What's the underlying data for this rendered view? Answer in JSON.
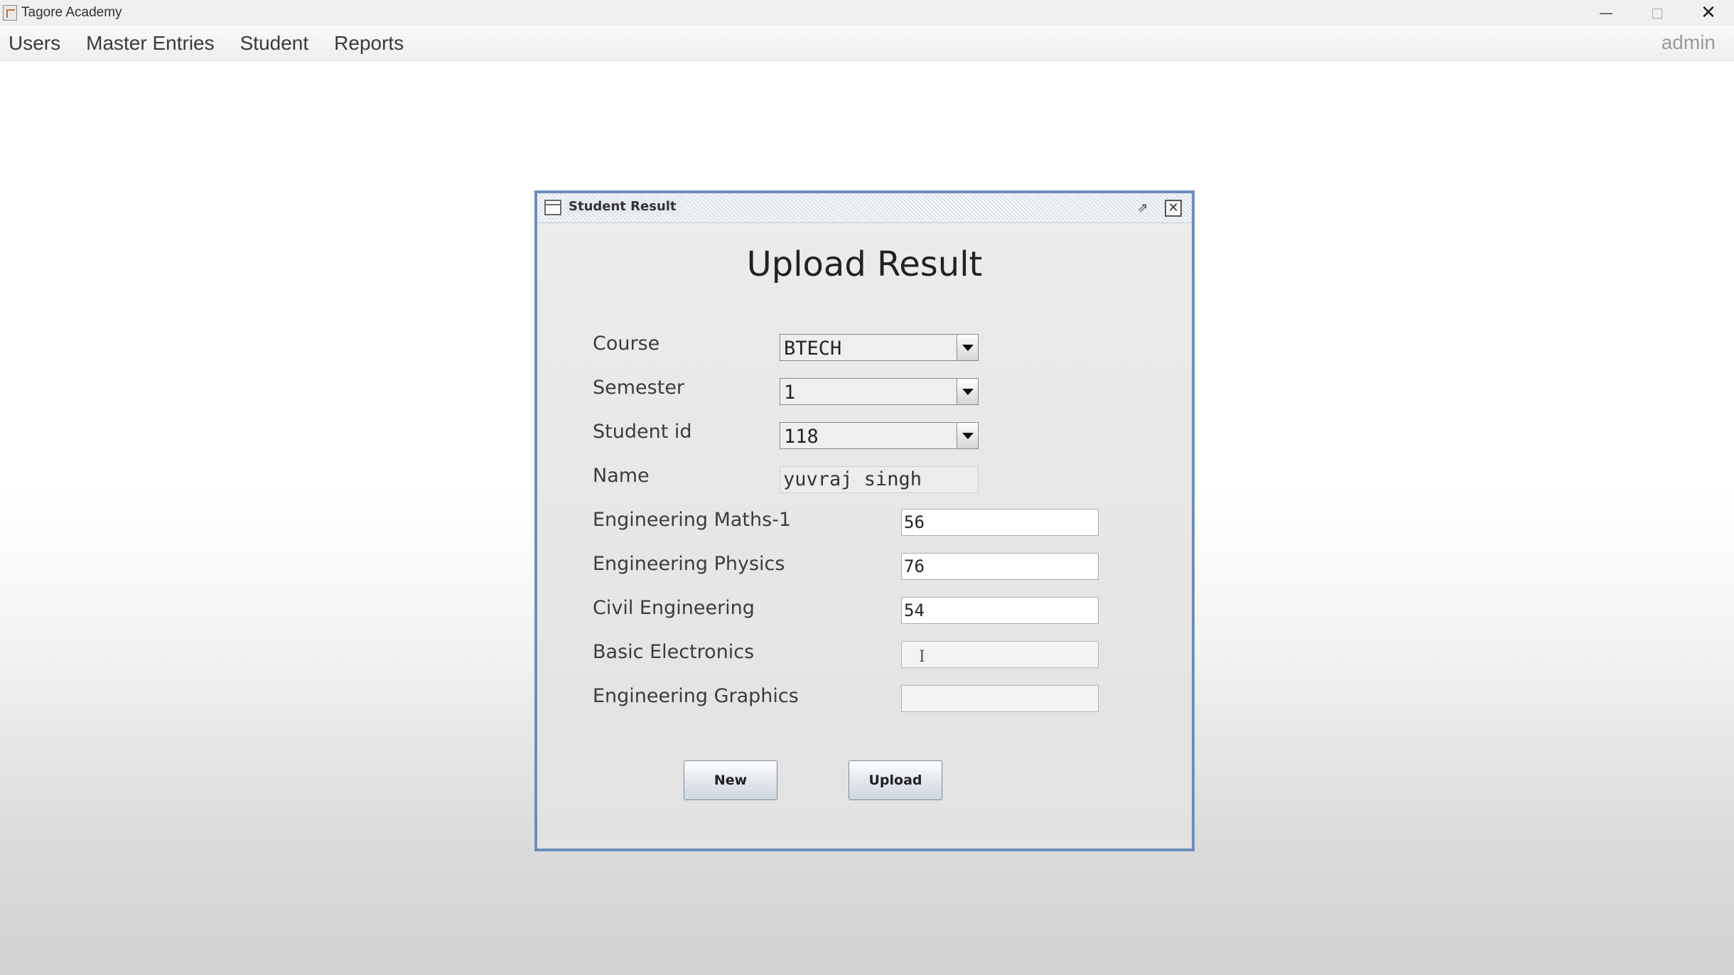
{
  "window": {
    "title": "Tagore Academy"
  },
  "menubar": {
    "items": [
      "Users",
      "Master Entries",
      "Student",
      "Reports"
    ],
    "user": "admin"
  },
  "dialog": {
    "frame_title": "Student Result",
    "heading": "Upload Result",
    "fields": {
      "course": {
        "label": "Course",
        "value": "BTECH"
      },
      "semester": {
        "label": "Semester",
        "value": "1"
      },
      "student_id": {
        "label": "Student id",
        "value": "118"
      },
      "name": {
        "label": "Name",
        "value": "yuvraj singh"
      }
    },
    "subjects": [
      {
        "label": "Engineering Maths-1",
        "value": "56"
      },
      {
        "label": "Engineering Physics",
        "value": "76"
      },
      {
        "label": "Civil Engineering",
        "value": "54"
      },
      {
        "label": "Basic Electronics",
        "value": ""
      },
      {
        "label": "Engineering Graphics",
        "value": ""
      }
    ],
    "buttons": {
      "new": "New",
      "upload": "Upload"
    }
  },
  "icons": [
    "app-icon",
    "minimize-icon",
    "maximize-icon",
    "close-icon",
    "frame-icon",
    "restore-icon",
    "frame-close-icon",
    "dropdown-arrow-icon",
    "text-cursor-icon"
  ]
}
